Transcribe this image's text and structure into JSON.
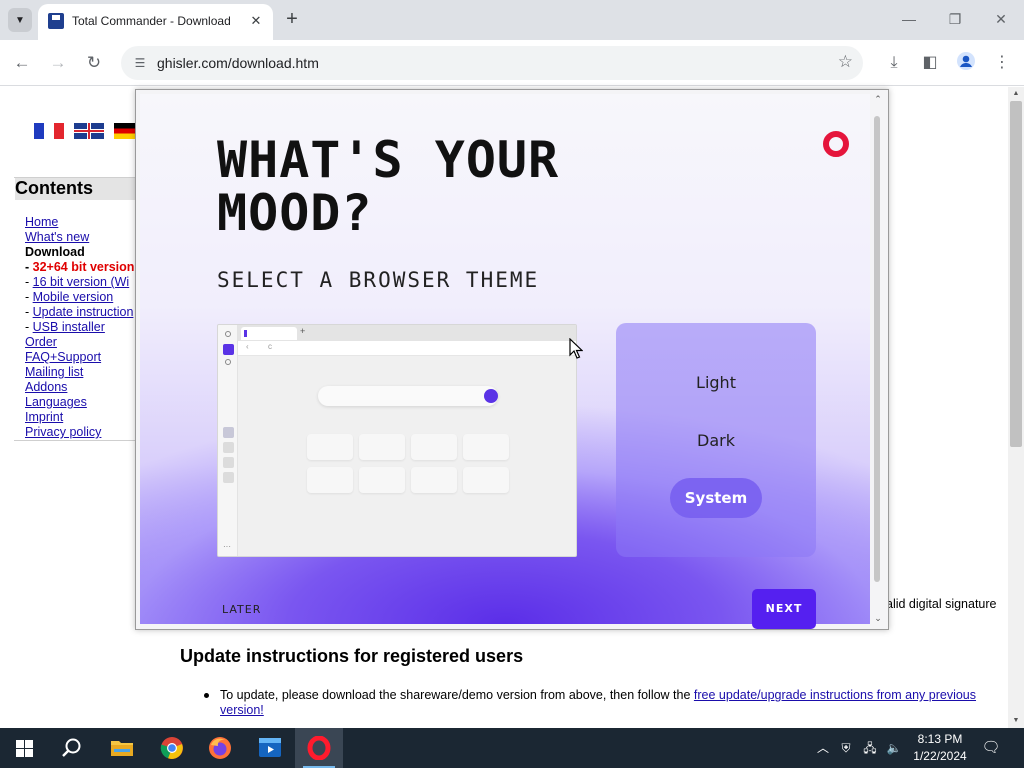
{
  "browser": {
    "tab_title": "Total Commander - Download",
    "url": "ghisler.com/download.htm",
    "new_tab_symbol": "+",
    "close_symbol": "✕"
  },
  "sidebar": {
    "heading": "Contents",
    "items": [
      {
        "label": "Home",
        "kind": "link"
      },
      {
        "label": "What's new",
        "kind": "link"
      },
      {
        "label": "Download",
        "kind": "current"
      },
      {
        "label": "32+64 bit version",
        "kind": "red",
        "prefix": "- "
      },
      {
        "label": "16 bit version (Wi",
        "kind": "link",
        "prefix": "- "
      },
      {
        "label": "Mobile version",
        "kind": "link",
        "prefix": "- "
      },
      {
        "label": "Update instruction",
        "kind": "link",
        "prefix": "- "
      },
      {
        "label": "USB installer",
        "kind": "link",
        "prefix": "- "
      },
      {
        "label": "Order",
        "kind": "link"
      },
      {
        "label": "FAQ+Support",
        "kind": "link"
      },
      {
        "label": "Mailing list",
        "kind": "link"
      },
      {
        "label": "Addons",
        "kind": "link"
      },
      {
        "label": "Languages",
        "kind": "link"
      },
      {
        "label": "Imprint",
        "kind": "link"
      },
      {
        "label": "Privacy policy",
        "kind": "link"
      }
    ]
  },
  "content": {
    "signature_text": "alid digital signature",
    "section_heading": "Update instructions for registered users",
    "bullet_text": "To update, please download the shareware/demo version from above, then follow the ",
    "bullet_link": "free update/upgrade instructions from any previous version!"
  },
  "modal": {
    "title": "WHAT'S YOUR MOOD?",
    "subtitle": "SELECT A BROWSER THEME",
    "themes": [
      "Light",
      "Dark",
      "System"
    ],
    "selected_theme": "System",
    "later_label": "LATER",
    "next_label": "NEXT",
    "accent_color": "#5520f0",
    "logo_color": "#e5153c"
  },
  "taskbar": {
    "time": "8:13 PM",
    "date": "1/22/2024",
    "apps": [
      "start",
      "search",
      "file-explorer",
      "chrome",
      "firefox",
      "media-app",
      "opera"
    ]
  }
}
